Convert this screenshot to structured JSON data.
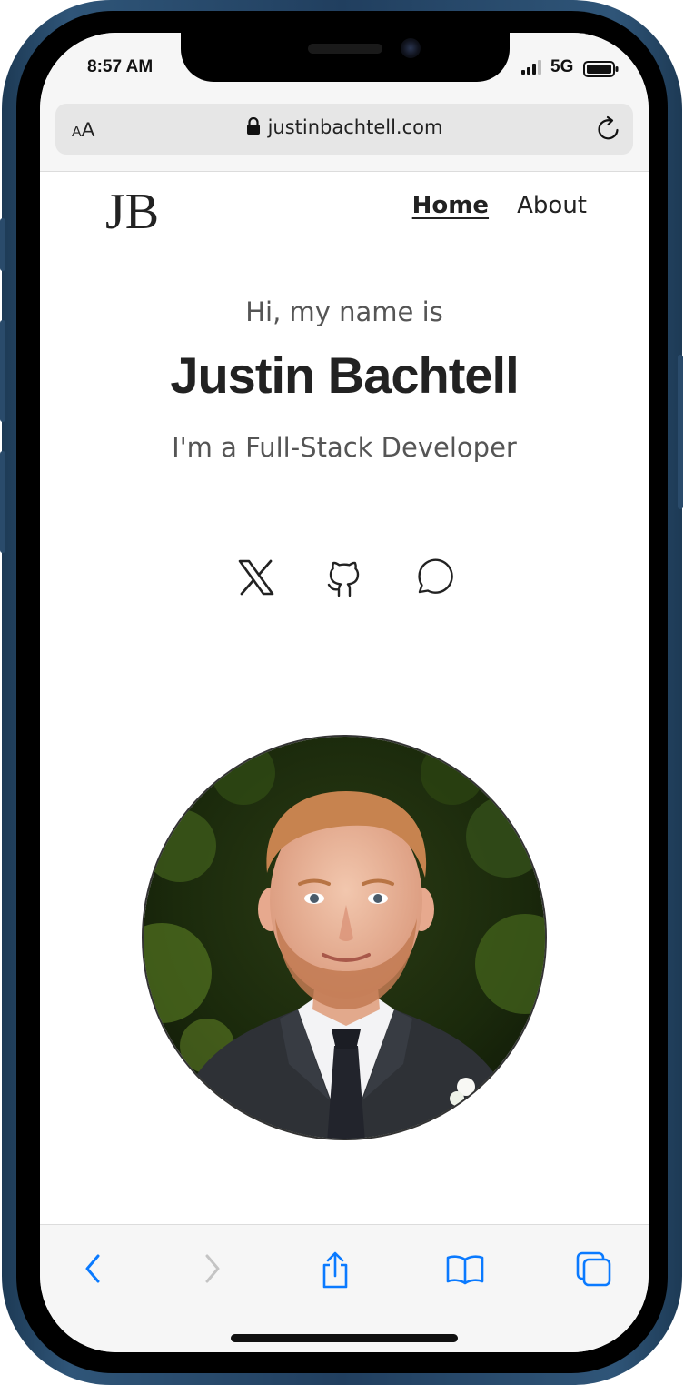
{
  "status_bar": {
    "time": "8:57 AM",
    "network": "5G"
  },
  "browser": {
    "text_size_small": "A",
    "text_size_large": "A",
    "url": "justinbachtell.com"
  },
  "site": {
    "logo": "JB",
    "nav": [
      {
        "label": "Home",
        "active": true
      },
      {
        "label": "About",
        "active": false
      }
    ]
  },
  "hero": {
    "greeting": "Hi, my name is",
    "name": "Justin Bachtell",
    "role": "I'm a Full-Stack Developer"
  },
  "social_icons": [
    "x-icon",
    "github-icon",
    "message-icon"
  ],
  "toolbar_icons": [
    "back-icon",
    "forward-icon",
    "share-icon",
    "bookmarks-icon",
    "tabs-icon"
  ],
  "colors": {
    "frame": "#2f5578",
    "ios_blue": "#0a7aff",
    "text_dark": "#222222",
    "text_muted": "#555555"
  }
}
